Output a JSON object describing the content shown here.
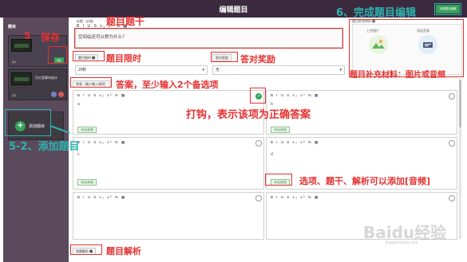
{
  "header": {
    "title": "编辑题目",
    "finish_label": "完成题目编辑"
  },
  "sidebar": {
    "section_label": "题目",
    "questions": [
      {
        "label": "Q1",
        "save_label": "保存"
      },
      {
        "label": "Q2",
        "text": "闪大是事年结计"
      }
    ],
    "add_label": "添加题目"
  },
  "editor": {
    "stem_label": "标题（必填）",
    "stem_toolbar": "B I U S x₂ x² % ▦",
    "stem_text": "空间站还可以称为什么？",
    "time_label": "题目限时 ❶",
    "time_value": "20秒",
    "reward_label": "答对奖励",
    "reward_value": "无",
    "answer_label": "答案（请少输入两项）",
    "option_toolbar": "B I U S x₂ x² % ▦",
    "audio_label": "添加[音频]",
    "explanation_label": "答题解析 ❶",
    "options": [
      {
        "letter": "a",
        "correct": true
      },
      {
        "letter": "b",
        "correct": false
      },
      {
        "letter": "c",
        "correct": false
      },
      {
        "letter": "d",
        "correct": false
      },
      {
        "letter": "",
        "correct": false
      },
      {
        "letter": "",
        "correct": false
      }
    ]
  },
  "material": {
    "label": "题目补充材料 ❶",
    "image_label": "上传图片",
    "audio_label": "添加音频"
  },
  "annotations": {
    "stem": "题目题干",
    "save": "保存",
    "time_limit": "题目限时",
    "reward": "答对奖励",
    "answers": "答案，至少输入2个备选项",
    "material": "题目补充材料：图片或音频",
    "correct": "打钩，表示该项为正确答案",
    "audio": "选项、题干、解析可以添加[音频]",
    "explanation": "题目解析",
    "finish": "6、完成题目编辑",
    "step5": "5",
    "add_question": "5-2、添加题目"
  },
  "watermark": {
    "text": "Baidu经验",
    "sub": "jingyan.baidu.com"
  }
}
